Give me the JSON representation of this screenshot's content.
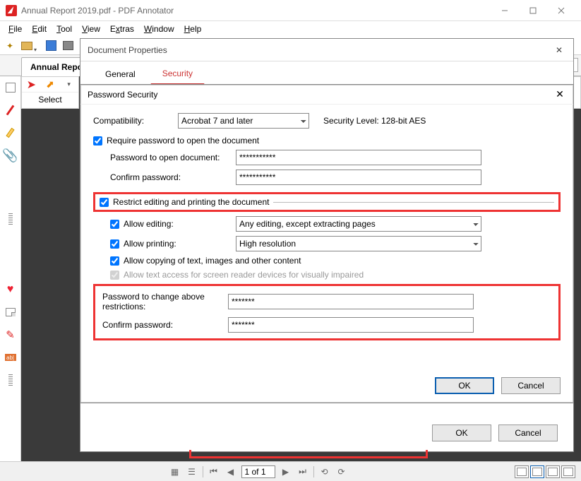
{
  "window": {
    "title": "Annual Report 2019.pdf - PDF Annotator"
  },
  "menu": {
    "file": "File",
    "edit": "Edit",
    "tool": "Tool",
    "view": "View",
    "extras": "Extras",
    "window": "Window",
    "help": "Help"
  },
  "doctab": {
    "name": "Annual Report"
  },
  "seltool": {
    "label": "Select"
  },
  "docprops": {
    "title": "Document Properties",
    "tabs": {
      "general": "General",
      "security": "Security"
    },
    "ok": "OK",
    "cancel": "Cancel"
  },
  "pw": {
    "title": "Password Security",
    "compat_label": "Compatibility:",
    "compat_value": "Acrobat 7 and later",
    "seclevel": "Security Level: 128-bit AES",
    "require_open": "Require password to open the document",
    "open_pw_label": "Password to open document:",
    "open_pw_value": "***********",
    "confirm_label": "Confirm password:",
    "confirm_value": "***********",
    "restrict": "Restrict editing and printing the document",
    "allow_editing": "Allow editing:",
    "editing_value": "Any editing, except extracting pages",
    "allow_printing": "Allow printing:",
    "printing_value": "High resolution",
    "allow_copy": "Allow copying of text, images and other content",
    "allow_reader": "Allow text access for screen reader devices for visually impaired",
    "change_pw_label": "Password to change above restrictions:",
    "change_pw_value": "*******",
    "confirm2_label": "Confirm password:",
    "confirm2_value": "*******",
    "ok": "OK",
    "cancel": "Cancel"
  },
  "status": {
    "page": "1 of 1"
  }
}
